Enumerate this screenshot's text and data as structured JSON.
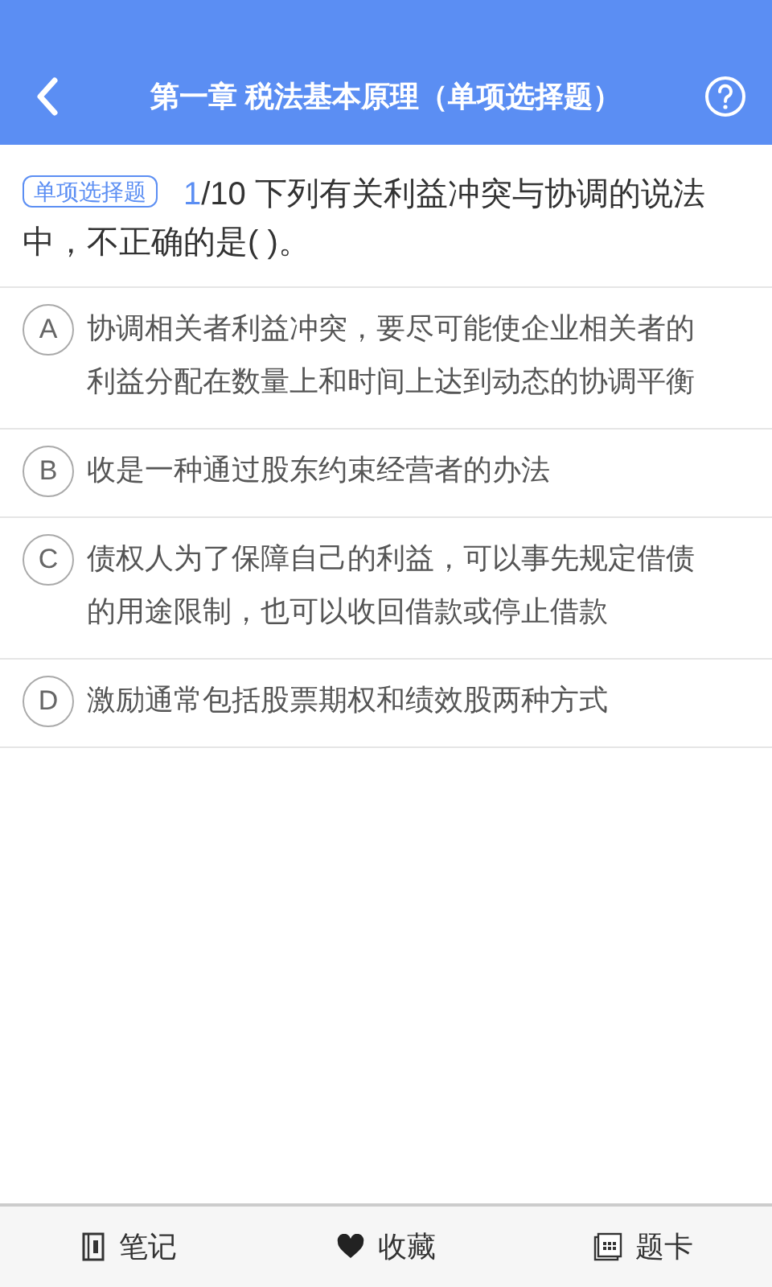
{
  "header": {
    "title": "第一章 税法基本原理（单项选择题）"
  },
  "question": {
    "type_tag": "单项选择题",
    "number": "1",
    "total": "/10",
    "text": "下列有关利益冲突与协调的说法中，不正确的是( )。"
  },
  "options": [
    {
      "letter": "A",
      "text": "协调相关者利益冲突，要尽可能使企业相关者的利益分配在数量上和时间上达到动态的协调平衡"
    },
    {
      "letter": "B",
      "text": "收是一种通过股东约束经营者的办法"
    },
    {
      "letter": "C",
      "text": "债权人为了保障自己的利益，可以事先规定借债的用途限制，也可以收回借款或停止借款"
    },
    {
      "letter": "D",
      "text": "激励通常包括股票期权和绩效股两种方式"
    }
  ],
  "bottom_bar": [
    {
      "kind": "notes",
      "label": "笔记"
    },
    {
      "kind": "favorite",
      "label": "收藏"
    },
    {
      "kind": "card",
      "label": "题卡"
    }
  ]
}
